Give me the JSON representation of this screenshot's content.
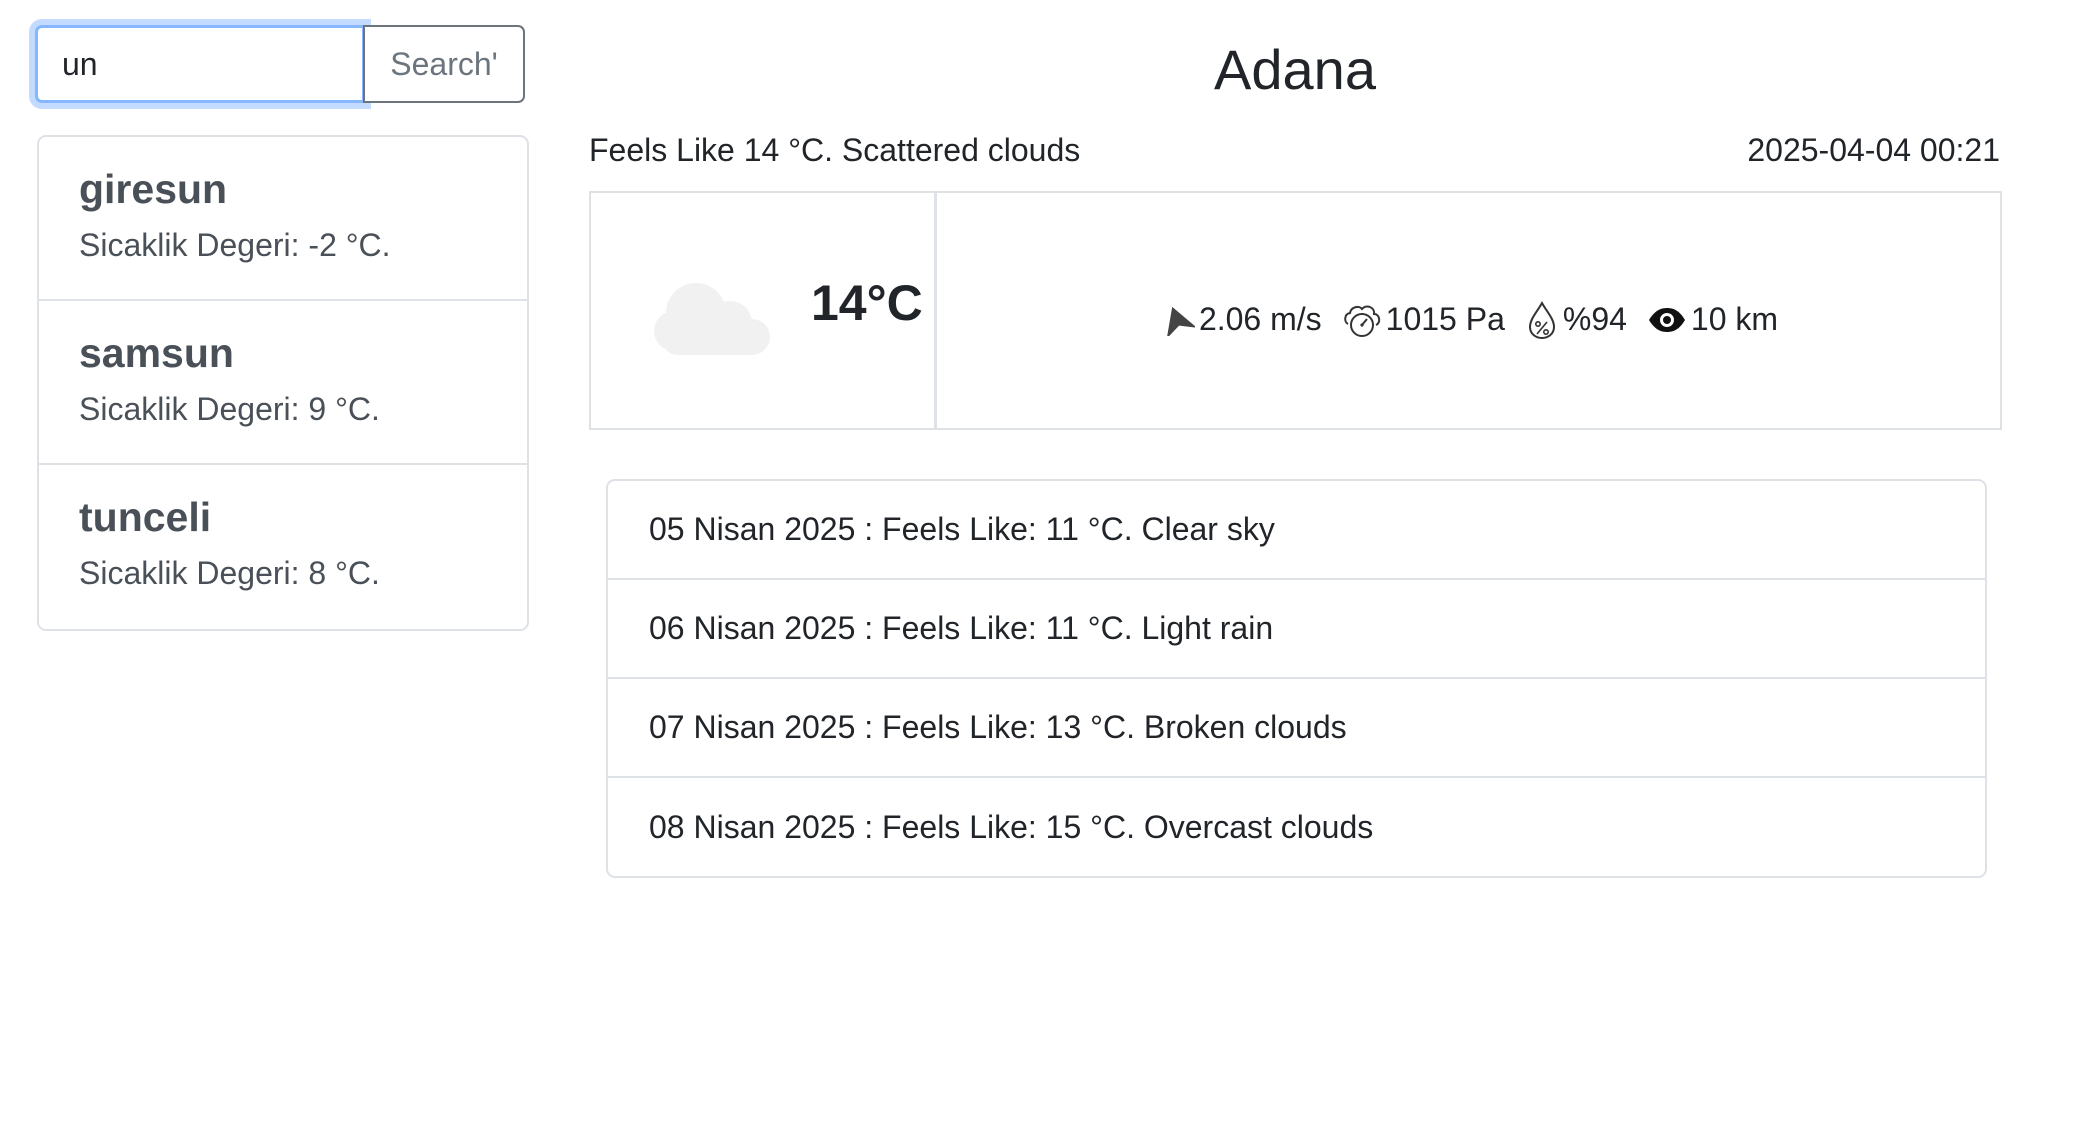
{
  "search": {
    "value": "un",
    "button_label": "Search'"
  },
  "cities": [
    {
      "name": "giresun",
      "temp": "Sicaklik Degeri: -2 °C."
    },
    {
      "name": "samsun",
      "temp": "Sicaklik Degeri: 9 °C."
    },
    {
      "name": "tunceli",
      "temp": "Sicaklik Degeri: 8 °C."
    }
  ],
  "weather": {
    "city": "Adana",
    "summary": "Feels Like 14 °C. Scattered clouds",
    "datetime": "2025-04-04 00:21",
    "temperature": "14°C",
    "icon": "cloud-icon",
    "wind": "2.06 m/s",
    "pressure": "1015 Pa",
    "humidity": "%94",
    "visibility": "10 km"
  },
  "forecast": [
    "05 Nisan 2025 : Feels Like: 11 °C. Clear sky",
    "06 Nisan 2025 : Feels Like: 11 °C. Light rain",
    "07 Nisan 2025 : Feels Like: 13 °C. Broken clouds",
    "08 Nisan 2025 : Feels Like: 15 °C. Overcast clouds"
  ],
  "colors": {
    "focus_border": "#86b7fe",
    "border": "#dee2e6",
    "muted_text": "#6c757d",
    "city_text": "#495057",
    "cloud": "#f1f1f1"
  }
}
